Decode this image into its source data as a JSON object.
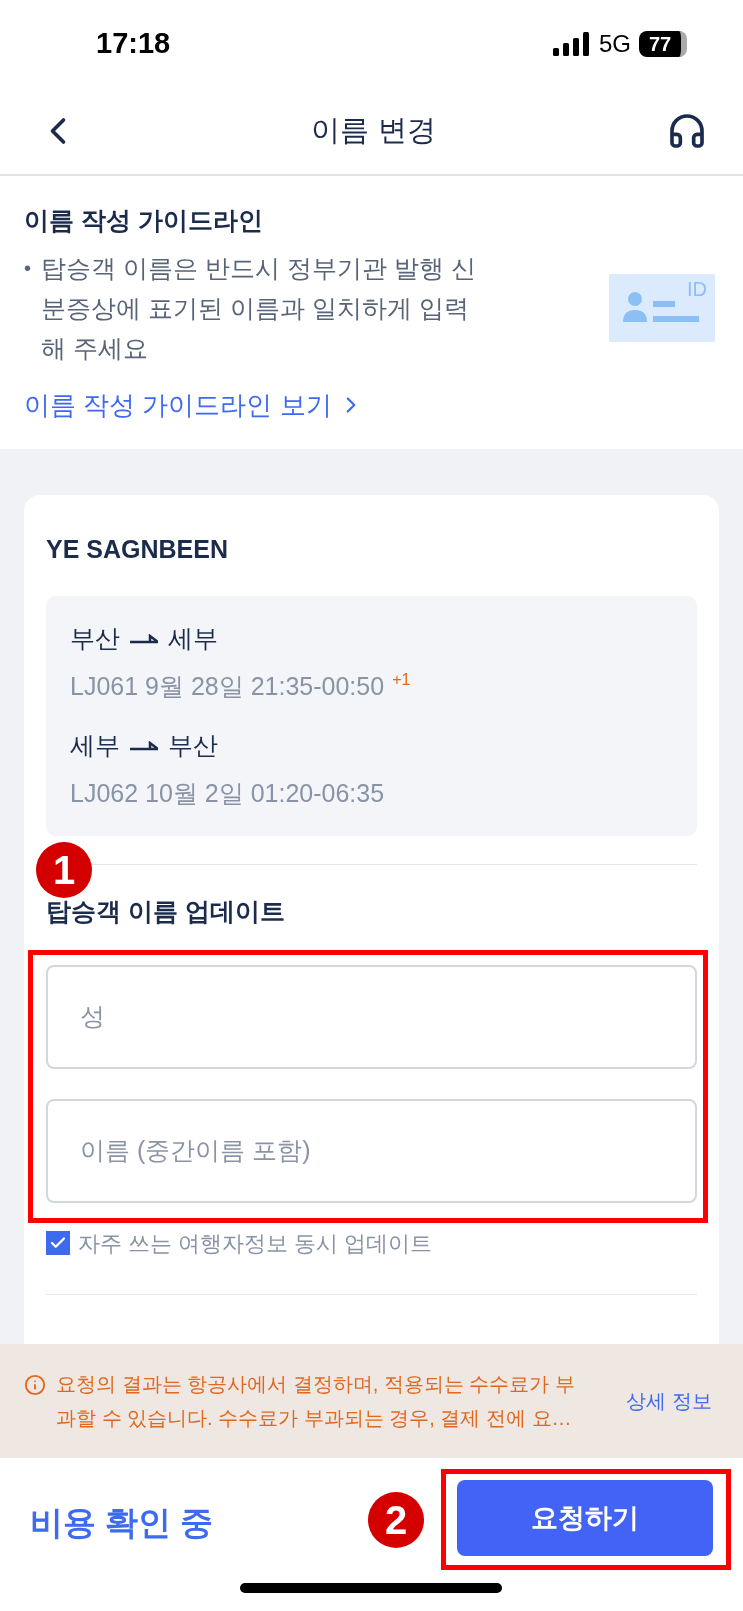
{
  "status_bar": {
    "time": "17:18",
    "network": "5G",
    "battery": "77"
  },
  "header": {
    "title": "이름 변경"
  },
  "guideline": {
    "title": "이름 작성 가이드라인",
    "bullet": "•",
    "text": "탑승객 이름은 반드시 정부기관 발행 신분증상에 표기된 이름과 일치하게 입력해 주세요",
    "id_badge": "ID",
    "link": "이름 작성 가이드라인 보기"
  },
  "passenger": {
    "name": "YE SAGNBEEN",
    "flights": [
      {
        "route_from": "부산",
        "route_to": "세부",
        "detail": "LJ061 9월 28일 21:35-00:50",
        "day_offset": "+1"
      },
      {
        "route_from": "세부",
        "route_to": "부산",
        "detail": "LJ062 10월 2일 01:20-06:35"
      }
    ],
    "update_title": "탑승객 이름 업데이트",
    "fields": [
      {
        "placeholder": "성"
      },
      {
        "placeholder": "이름 (중간이름 포함)"
      }
    ],
    "checkbox": {
      "label": "자주 쓰는 여행자정보 동시 업데이트",
      "checked": true
    }
  },
  "notice": {
    "text": "요청의 결과는 항공사에서 결정하며, 적용되는 수수료가 부과할 수 있습니다. 수수료가 부과되는 경우, 결제 전에 요…",
    "link": "상세 정보"
  },
  "footer": {
    "status": "비용 확인 중",
    "button": "요청하기"
  },
  "annotations": [
    {
      "label": "1"
    },
    {
      "label": "2"
    }
  ]
}
